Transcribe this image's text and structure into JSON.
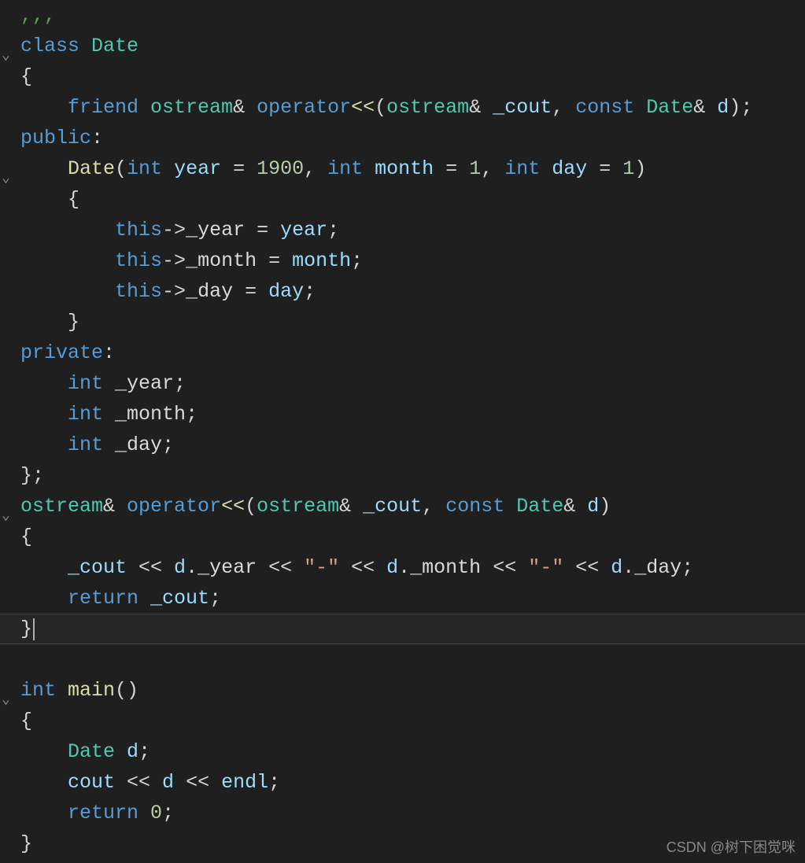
{
  "code": {
    "lines": [
      {
        "fold": "",
        "indent": 0,
        "html": "<span class='tok-comment'>,,,</span>"
      },
      {
        "fold": "v",
        "indent": 0,
        "html": "<span class='tok-keyword'>class</span> <span class='tok-type'>Date</span>"
      },
      {
        "fold": "",
        "indent": 0,
        "html": "{"
      },
      {
        "fold": "",
        "indent": 1,
        "html": "    <span class='tok-keyword'>friend</span> <span class='tok-type'>ostream</span>&amp; <span class='tok-keyword'>operator</span><span class='tok-func'>&lt;&lt;</span>(<span class='tok-type'>ostream</span>&amp; <span class='tok-param'>_cout</span>, <span class='tok-keyword'>const</span> <span class='tok-type'>Date</span>&amp; <span class='tok-param'>d</span>);"
      },
      {
        "fold": "",
        "indent": 0,
        "html": "<span class='tok-keyword'>public</span>:"
      },
      {
        "fold": "v",
        "indent": 1,
        "html": "    <span class='tok-func'>Date</span>(<span class='tok-keyword'>int</span> <span class='tok-param'>year</span> = <span class='tok-num'>1900</span>, <span class='tok-keyword'>int</span> <span class='tok-param'>month</span> = <span class='tok-num'>1</span>, <span class='tok-keyword'>int</span> <span class='tok-param'>day</span> = <span class='tok-num'>1</span>)"
      },
      {
        "fold": "",
        "indent": 1,
        "html": "    {"
      },
      {
        "fold": "",
        "indent": 2,
        "html": "        <span class='tok-keyword'>this</span>-&gt;<span class='tok-member'>_year</span> = <span class='tok-param'>year</span>;"
      },
      {
        "fold": "",
        "indent": 2,
        "html": "        <span class='tok-keyword'>this</span>-&gt;<span class='tok-member'>_month</span> = <span class='tok-param'>month</span>;"
      },
      {
        "fold": "",
        "indent": 2,
        "html": "        <span class='tok-keyword'>this</span>-&gt;<span class='tok-member'>_day</span> = <span class='tok-param'>day</span>;"
      },
      {
        "fold": "",
        "indent": 1,
        "html": "    }"
      },
      {
        "fold": "",
        "indent": 0,
        "html": "<span class='tok-keyword'>private</span>:"
      },
      {
        "fold": "",
        "indent": 1,
        "html": "    <span class='tok-keyword'>int</span> <span class='tok-member'>_year</span>;"
      },
      {
        "fold": "",
        "indent": 1,
        "html": "    <span class='tok-keyword'>int</span> <span class='tok-member'>_month</span>;"
      },
      {
        "fold": "",
        "indent": 1,
        "html": "    <span class='tok-keyword'>int</span> <span class='tok-member'>_day</span>;"
      },
      {
        "fold": "",
        "indent": 0,
        "html": "};"
      },
      {
        "fold": "v",
        "indent": 0,
        "html": "<span class='tok-type'>ostream</span>&amp; <span class='tok-keyword'>operator</span><span class='tok-func'>&lt;&lt;</span>(<span class='tok-type'>ostream</span>&amp; <span class='tok-param'>_cout</span>, <span class='tok-keyword'>const</span> <span class='tok-type'>Date</span>&amp; <span class='tok-param'>d</span>)"
      },
      {
        "fold": "",
        "indent": 0,
        "html": "{"
      },
      {
        "fold": "",
        "indent": 1,
        "html": "    <span class='tok-param'>_cout</span> &lt;&lt; <span class='tok-param'>d</span>.<span class='tok-member'>_year</span> &lt;&lt; <span class='tok-str'>&quot;-&quot;</span> &lt;&lt; <span class='tok-param'>d</span>.<span class='tok-member'>_month</span> &lt;&lt; <span class='tok-str'>&quot;-&quot;</span> &lt;&lt; <span class='tok-param'>d</span>.<span class='tok-member'>_day</span>;"
      },
      {
        "fold": "",
        "indent": 1,
        "html": "    <span class='tok-keyword'>return</span> <span class='tok-param'>_cout</span>;"
      },
      {
        "fold": "",
        "indent": 0,
        "html": "}",
        "cursor": true
      },
      {
        "fold": "",
        "indent": 0,
        "html": ""
      },
      {
        "fold": "v",
        "indent": 0,
        "html": "<span class='tok-keyword'>int</span> <span class='tok-func'>main</span>()"
      },
      {
        "fold": "",
        "indent": 0,
        "html": "{"
      },
      {
        "fold": "",
        "indent": 1,
        "html": "    <span class='tok-type'>Date</span> <span class='tok-param'>d</span>;"
      },
      {
        "fold": "",
        "indent": 1,
        "html": "    <span class='tok-param'>cout</span> &lt;&lt; <span class='tok-param'>d</span> &lt;&lt; <span class='tok-param'>endl</span>;"
      },
      {
        "fold": "",
        "indent": 1,
        "html": "    <span class='tok-keyword'>return</span> <span class='tok-num'>0</span>;"
      },
      {
        "fold": "",
        "indent": 0,
        "html": "}"
      }
    ]
  },
  "watermark": "CSDN @树下困觉咪"
}
